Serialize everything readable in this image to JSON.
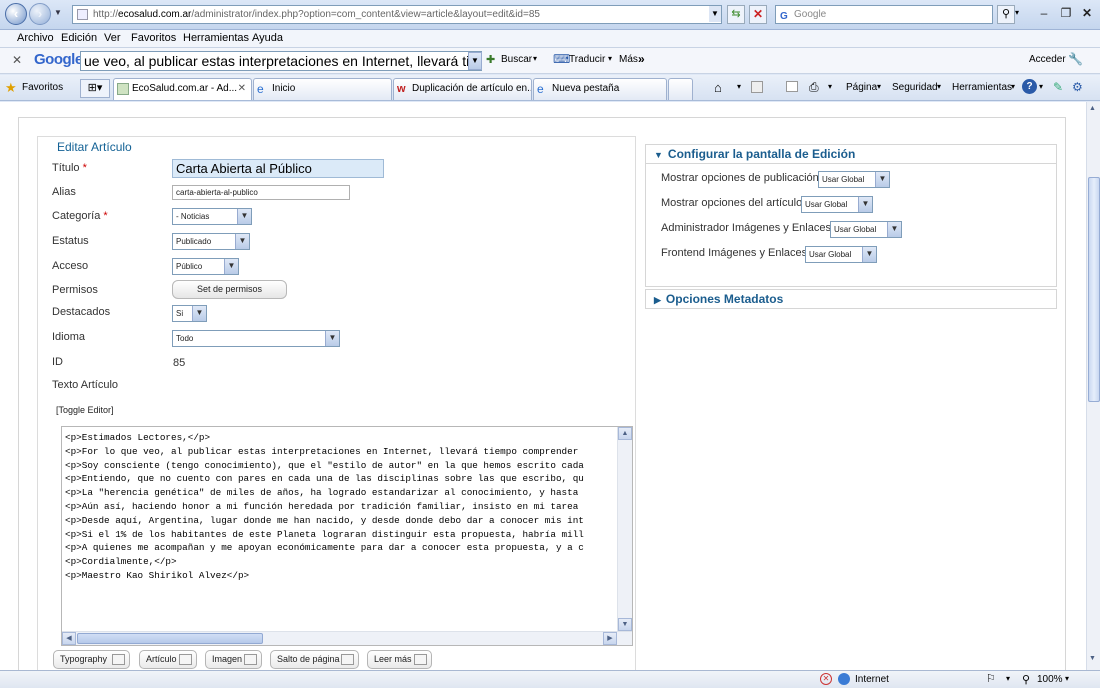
{
  "browser": {
    "url_prefix": "http://",
    "url_domain": "ecosalud.com.ar",
    "url_rest": "/administrator/index.php?option=com_content&view=article&layout=edit&id=85",
    "search_placeholder": "Google"
  },
  "menubar": [
    "Archivo",
    "Edición",
    "Ver",
    "Favoritos",
    "Herramientas",
    "Ayuda"
  ],
  "google_toolbar": {
    "logo": "Google",
    "query": "ue veo, al publicar estas interpretaciones en Internet, llevará tiempo",
    "search": "Buscar",
    "translate": "Traducir",
    "more": "Más",
    "signin": "Acceder"
  },
  "favbar": {
    "favorites": "Favoritos",
    "tabs": [
      "EcoSalud.com.ar - Ad...",
      "Inicio",
      "Duplicación de artículo en...",
      "Nueva pestaña"
    ],
    "tools": [
      "Página",
      "Seguridad",
      "Herramientas"
    ]
  },
  "form": {
    "legend": "Editar Artículo",
    "title_label": "Título",
    "title_value": "Carta Abierta al Público",
    "alias_label": "Alias",
    "alias_value": "carta-abierta-al-publico",
    "category_label": "Categoría",
    "category_value": "- Noticias",
    "status_label": "Estatus",
    "status_value": "Publicado",
    "access_label": "Acceso",
    "access_value": "Público",
    "permissions_label": "Permisos",
    "permissions_button": "Set de permisos",
    "featured_label": "Destacados",
    "featured_value": "Si",
    "language_label": "Idioma",
    "language_value": "Todo",
    "id_label": "ID",
    "id_value": "85",
    "text_label": "Texto Artículo",
    "toggle_editor": "[Toggle Editor]",
    "required_mark": "*"
  },
  "editor_lines": [
    "<p>Estimados Lectores,</p>",
    "<p>For lo que veo, al publicar estas interpretaciones en Internet, llevará tiempo comprender",
    "<p>Soy consciente (tengo conocimiento), que el \"estilo de autor\" en la que hemos escrito cada",
    "<p>Entiendo, que no cuento con pares en cada una de las disciplinas sobre las que escribo, qu",
    "<p>La \"herencia genética\" de miles de años, ha logrado estandarizar al conocimiento, y hasta",
    "<p>Aún así, haciendo honor a mi función heredada por tradición familiar, insisto en mi tarea",
    "<p>Desde aquí, Argentina, lugar donde me han nacido, y desde donde debo dar a conocer mis int",
    "<p>Si el 1% de los habitantes de este Planeta lograran distinguir esta propuesta, habría mill",
    "<p>A quienes me acompañan y me apoyan económicamente para dar a conocer esta propuesta, y a c",
    "<p>Cordialmente,</p>",
    "<p>Maestro Kao Shirikol Alvez</p>"
  ],
  "editor_buttons": [
    "Typography",
    "Artículo",
    "Imagen",
    "Salto de página",
    "Leer más"
  ],
  "config": {
    "header": "Configurar la pantalla de Edición",
    "rows": [
      {
        "label": "Mostrar opciones de publicación",
        "value": "Usar Global"
      },
      {
        "label": "Mostrar opciones del artículo",
        "value": "Usar Global"
      },
      {
        "label": "Administrador Imágenes y Enlaces",
        "value": "Usar Global"
      },
      {
        "label": "Frontend Imágenes y Enlaces",
        "value": "Usar Global"
      }
    ],
    "metadata_header": "Opciones Metadatos"
  },
  "statusbar": {
    "zone": "Internet",
    "zoom": "100%"
  }
}
